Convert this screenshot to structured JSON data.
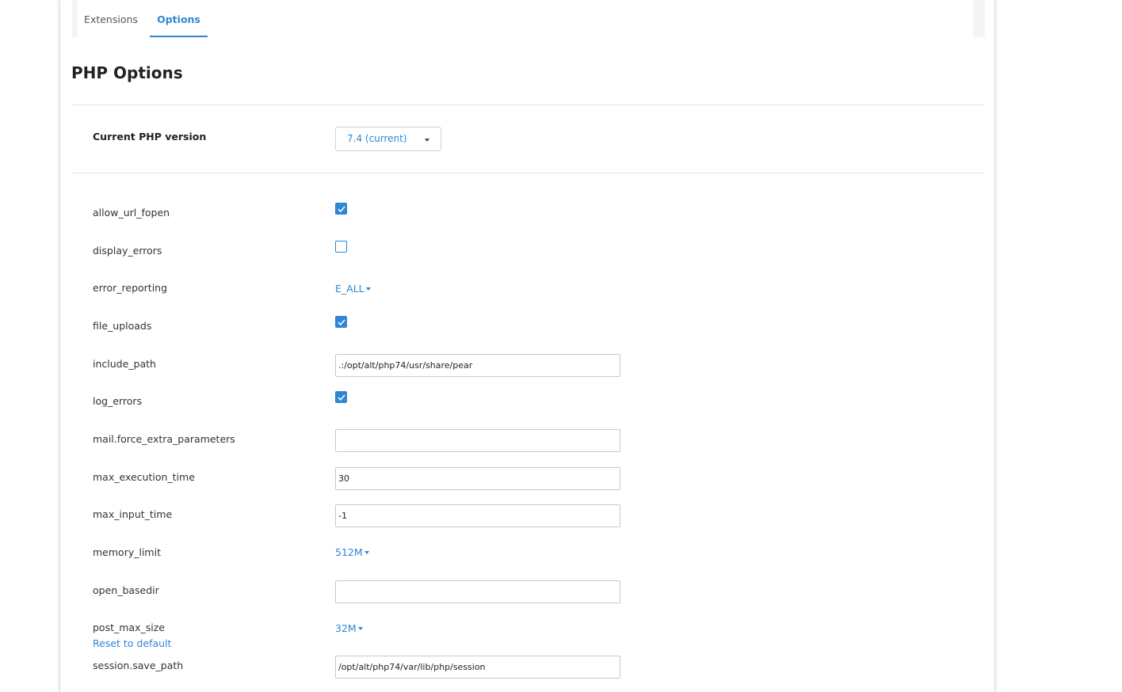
{
  "tabs": [
    {
      "label": "Extensions",
      "active": false
    },
    {
      "label": "Options",
      "active": true
    }
  ],
  "page_title": "PHP Options",
  "version": {
    "label": "Current PHP version",
    "value": "7.4 (current)"
  },
  "options": {
    "allow_url_fopen": {
      "label": "allow_url_fopen",
      "checked": true
    },
    "display_errors": {
      "label": "display_errors",
      "checked": false
    },
    "error_reporting": {
      "label": "error_reporting",
      "value": "E_ALL"
    },
    "file_uploads": {
      "label": "file_uploads",
      "checked": true
    },
    "include_path": {
      "label": "include_path",
      "value": ".:/opt/alt/php74/usr/share/pear"
    },
    "log_errors": {
      "label": "log_errors",
      "checked": true
    },
    "mail_force_extra_parameters": {
      "label": "mail.force_extra_parameters",
      "value": ""
    },
    "max_execution_time": {
      "label": "max_execution_time",
      "value": "30"
    },
    "max_input_time": {
      "label": "max_input_time",
      "value": "-1"
    },
    "memory_limit": {
      "label": "memory_limit",
      "value": "512M"
    },
    "open_basedir": {
      "label": "open_basedir",
      "value": ""
    },
    "post_max_size": {
      "label": "post_max_size",
      "value": "32M",
      "reset_label": "Reset to default"
    },
    "session_save_path": {
      "label": "session.save_path",
      "value": "/opt/alt/php74/var/lib/php/session"
    }
  },
  "colors": {
    "accent": "#2f86d4"
  }
}
